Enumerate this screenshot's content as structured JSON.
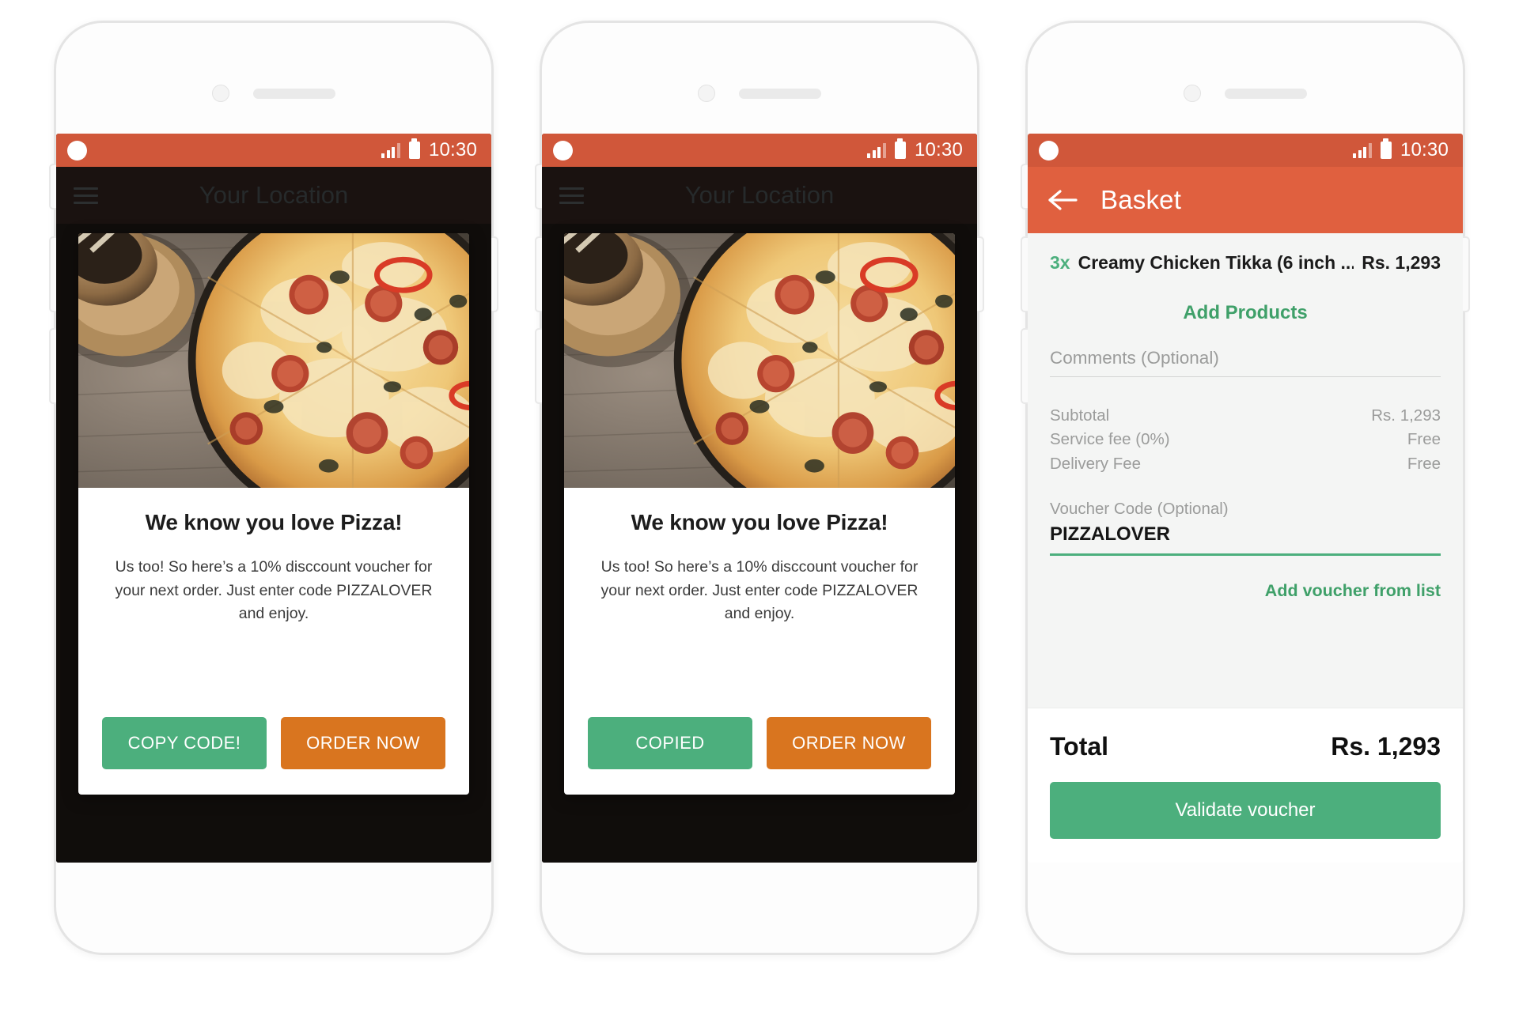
{
  "status_bar": {
    "time": "10:30",
    "signal_icon": "signal-bars-icon",
    "battery_icon": "battery-icon",
    "dot_icon": "status-dot-icon"
  },
  "colors": {
    "status_orange": "#d0573a",
    "header_orange": "#e0603f",
    "accent_green": "#4caf7d",
    "link_green": "#3fa069",
    "order_orange": "#d9751f",
    "dark_header": "#1a1210"
  },
  "phones": [
    {
      "id": "phone-voucher-initial",
      "app_header": {
        "menu_icon": "hamburger-menu-icon",
        "title": "Your Location"
      },
      "dialog": {
        "hero_image_alt": "pepperoni-pizza-photo",
        "title": "We know you love Pizza!",
        "body": "Us too! So here’s a 10% disccount voucher for your next order. Just enter code PIZZALOVER and enjoy.",
        "primary_button": "COPY CODE!",
        "secondary_button": "ORDER NOW"
      }
    },
    {
      "id": "phone-voucher-copied",
      "app_header": {
        "menu_icon": "hamburger-menu-icon",
        "title": "Your Location"
      },
      "dialog": {
        "hero_image_alt": "pepperoni-pizza-photo",
        "title": "We know you love Pizza!",
        "body": "Us too! So here’s a 10% disccount voucher for your next order. Just enter code PIZZALOVER and enjoy.",
        "primary_button": "COPIED",
        "secondary_button": "ORDER NOW"
      }
    }
  ],
  "basket": {
    "header": {
      "back_icon": "back-arrow-icon",
      "title": "Basket"
    },
    "items": [
      {
        "qty": "3x",
        "name": "Creamy Chicken Tikka (6 inch ...",
        "price": "Rs. 1,293"
      }
    ],
    "add_products_label": "Add Products",
    "comments_placeholder": "Comments (Optional)",
    "fees": [
      {
        "label": "Subtotal",
        "value": "Rs. 1,293"
      },
      {
        "label": "Service fee (0%)",
        "value": "Free"
      },
      {
        "label": "Delivery Fee",
        "value": "Free"
      }
    ],
    "voucher": {
      "label": "Voucher Code (Optional)",
      "value": "PIZZALOVER",
      "add_from_list_label": "Add voucher from list"
    },
    "total": {
      "label": "Total",
      "value": "Rs. 1,293"
    },
    "validate_button": "Validate voucher"
  }
}
